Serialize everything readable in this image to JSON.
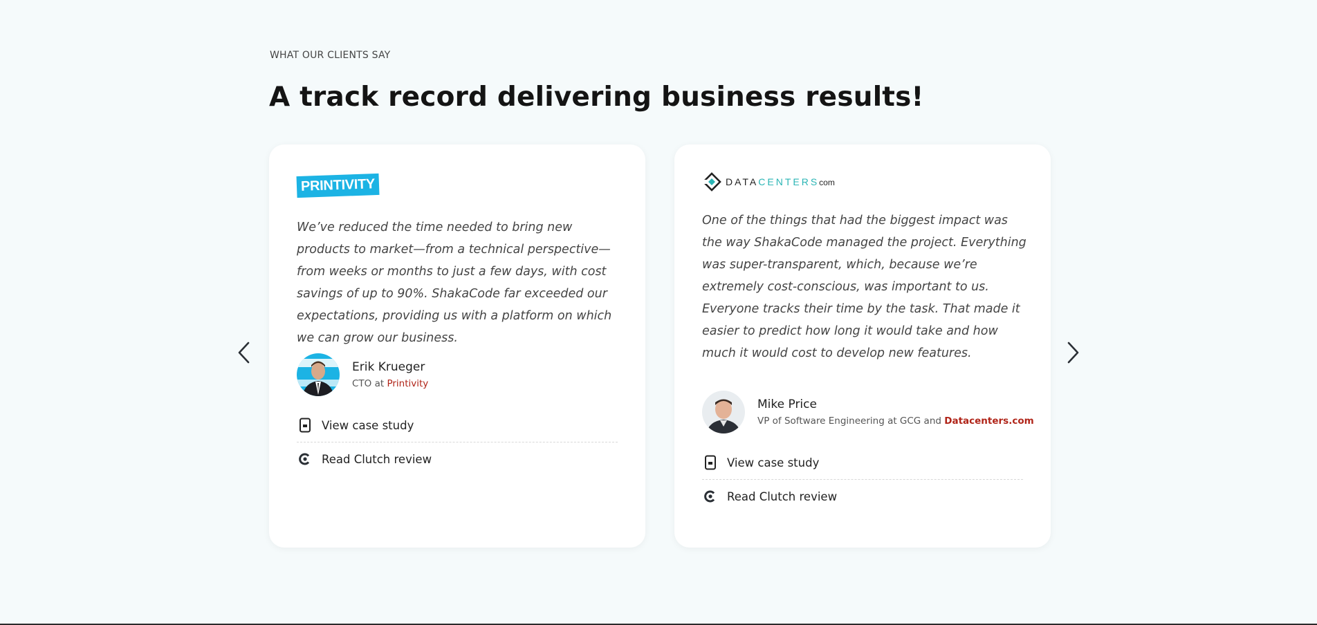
{
  "section": {
    "eyebrow": "WHAT OUR CLIENTS SAY",
    "title": "A track record delivering business results!"
  },
  "carousel": {
    "prev_icon": "chevron-left-icon",
    "next_icon": "chevron-right-icon"
  },
  "testimonials": [
    {
      "logo_text": "PRINTIVITY",
      "quote": "We’ve reduced the time needed to bring new products to market—from a technical perspective—from weeks or months to just a few days, with cost savings of up to 90%. ShakaCode far exceeded our expectations, providing us with a platform on which we can grow our business.",
      "name": "Erik Krueger",
      "role_prefix": "CTO at ",
      "company": "Printivity",
      "links": [
        {
          "label": "View case study",
          "icon": "document-icon"
        },
        {
          "label": "Read Clutch review",
          "icon": "clutch-icon"
        }
      ]
    },
    {
      "logo_parts": [
        "DATA",
        "CENTERS",
        "com"
      ],
      "quote": "One of the things that had the biggest impact was the way ShakaCode managed the project. Everything was super-transparent, which, because we’re extremely cost-conscious, was important to us. Everyone tracks their time by the task. That made it easier to predict how long it would take and how much it would cost to develop new features.",
      "name": "Mike Price",
      "role_prefix": "VP of Software Engineering at GCG and ",
      "company": "Datacenters.com",
      "links": [
        {
          "label": "View case study",
          "icon": "document-icon"
        },
        {
          "label": "Read Clutch review",
          "icon": "clutch-icon"
        }
      ]
    }
  ],
  "colors": {
    "background": "#f5fafb",
    "link_accent": "#b02418",
    "printivity_blue": "#1cb3e4",
    "datacenters_teal": "#2ab5b5"
  }
}
